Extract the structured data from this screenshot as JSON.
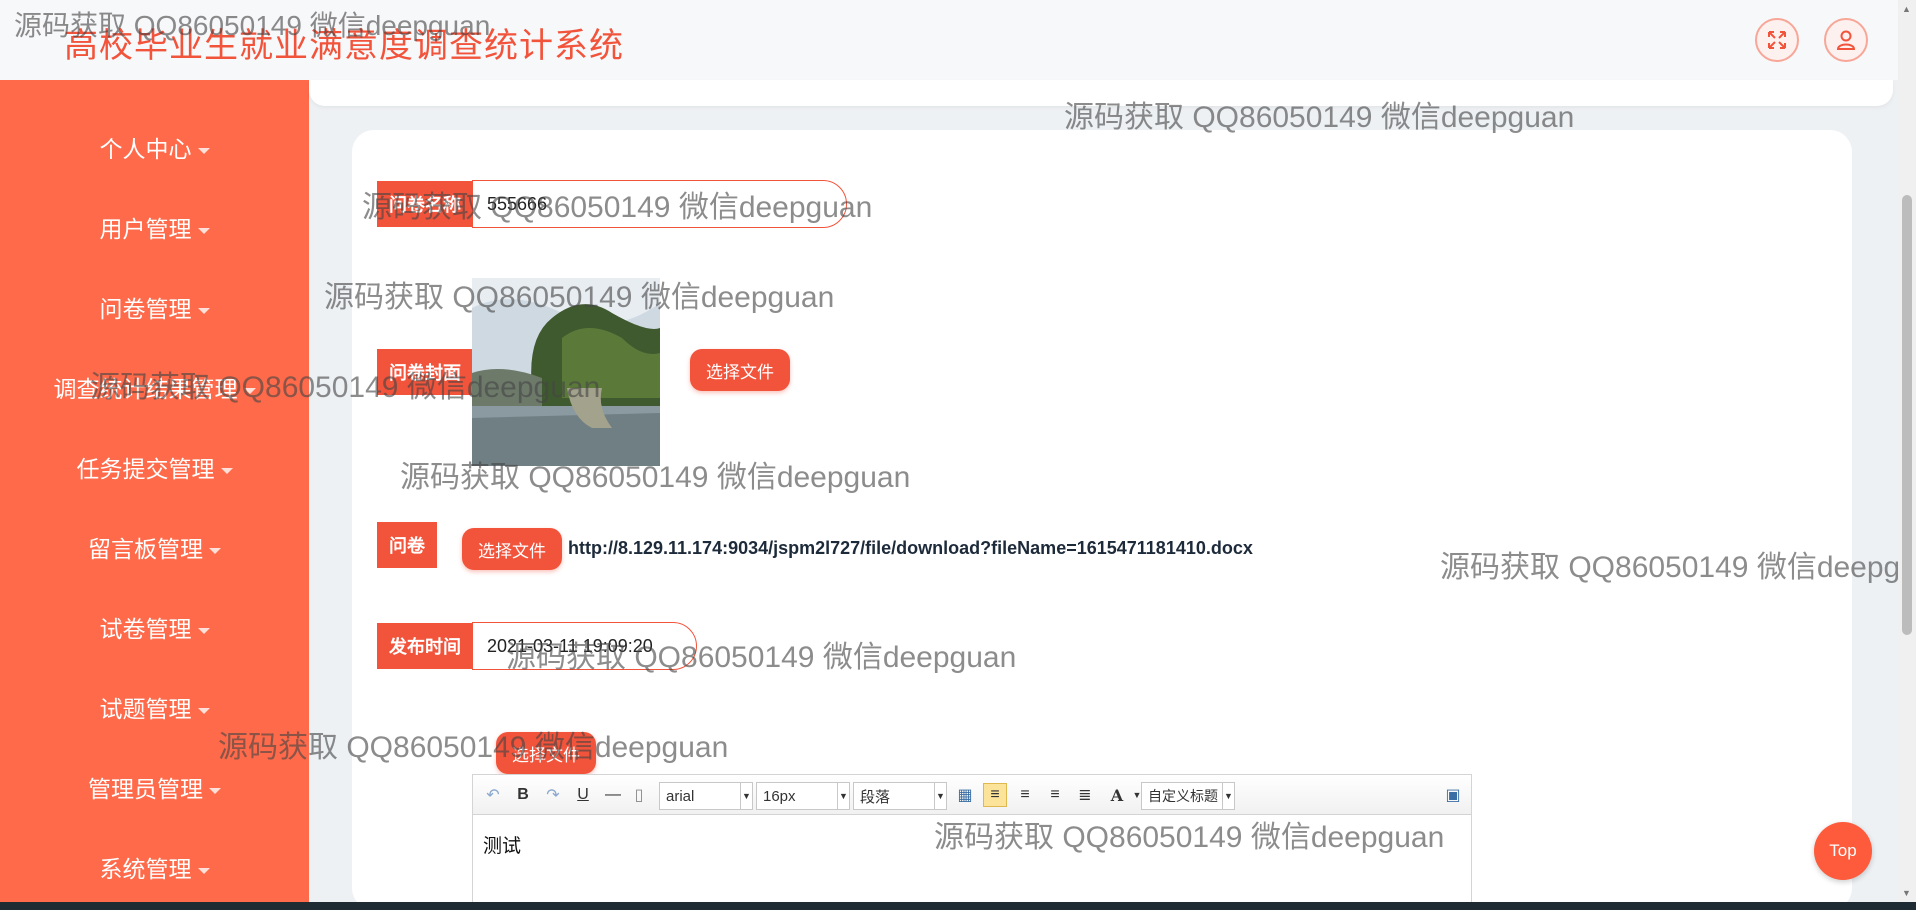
{
  "header": {
    "title": "高校毕业生就业满意度调查统计系统",
    "fullscreen_icon": "expand-arrows-icon",
    "user_icon": "user-icon"
  },
  "sidebar": {
    "items": [
      {
        "label": "个人中心"
      },
      {
        "label": "用户管理"
      },
      {
        "label": "问卷管理"
      },
      {
        "label": "调查统计结果管理"
      },
      {
        "label": "任务提交管理"
      },
      {
        "label": "留言板管理"
      },
      {
        "label": "试卷管理"
      },
      {
        "label": "试题管理"
      },
      {
        "label": "管理员管理"
      },
      {
        "label": "系统管理"
      }
    ]
  },
  "form": {
    "name_field": {
      "label": "问卷名称",
      "value": "555666"
    },
    "cover_field": {
      "label": "问卷封面",
      "button": "选择文件"
    },
    "file_field": {
      "label": "问卷",
      "button": "选择文件",
      "link": "http://8.129.11.174:9034/jspm2l727/file/download?fileName=1615471181410.docx"
    },
    "time_field": {
      "label": "发布时间",
      "value": "2021-03-11 19:09:20"
    },
    "content_button": "选择文件"
  },
  "editor": {
    "font_family": "arial",
    "font_size": "16px",
    "paragraph": "段落",
    "custom_title": "自定义标题",
    "content": "测试"
  },
  "watermark": "源码获取 QQ86050149 微信deepguan",
  "top_button": "Top",
  "colors": {
    "accent": "#f2533b",
    "sidebar": "#fe6a4a"
  }
}
